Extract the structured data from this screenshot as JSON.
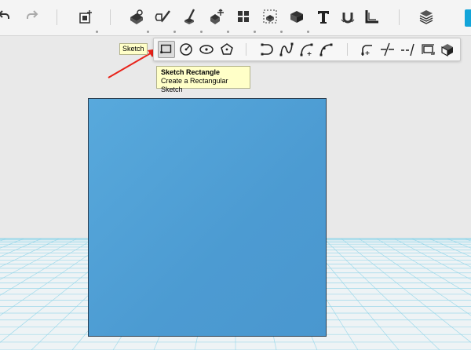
{
  "toolbar": {
    "icons": [
      "undo-icon",
      "redo-icon",
      "primitives-icon",
      "construct-icon",
      "sketch-icon",
      "modify-icon",
      "transform-icon",
      "pattern-icon",
      "group-icon",
      "combine-icon",
      "text-icon",
      "snap-icon",
      "measure-icon",
      "material-icon"
    ]
  },
  "sub_toolbar": {
    "tools": [
      "sketch-rectangle",
      "sketch-circle",
      "sketch-ellipse",
      "sketch-polygon",
      "sketch-polyline",
      "sketch-spline",
      "sketch-two-point-arc",
      "sketch-three-point-arc",
      "sketch-fillet",
      "sketch-trim",
      "sketch-extend",
      "sketch-offset",
      "sketch-project"
    ]
  },
  "tooltips": {
    "sketch_label": "Sketch",
    "rect_title": "Sketch Rectangle",
    "rect_desc": "Create a Rectangular Sketch"
  },
  "colors": {
    "toolbar_bg": "#f4f4f4",
    "box_fill": "#4f9fd6",
    "grid_line": "#8fd4e8",
    "arrow": "#e8231a",
    "tooltip_bg": "#ffffc8",
    "accent": "#12a4d9"
  }
}
